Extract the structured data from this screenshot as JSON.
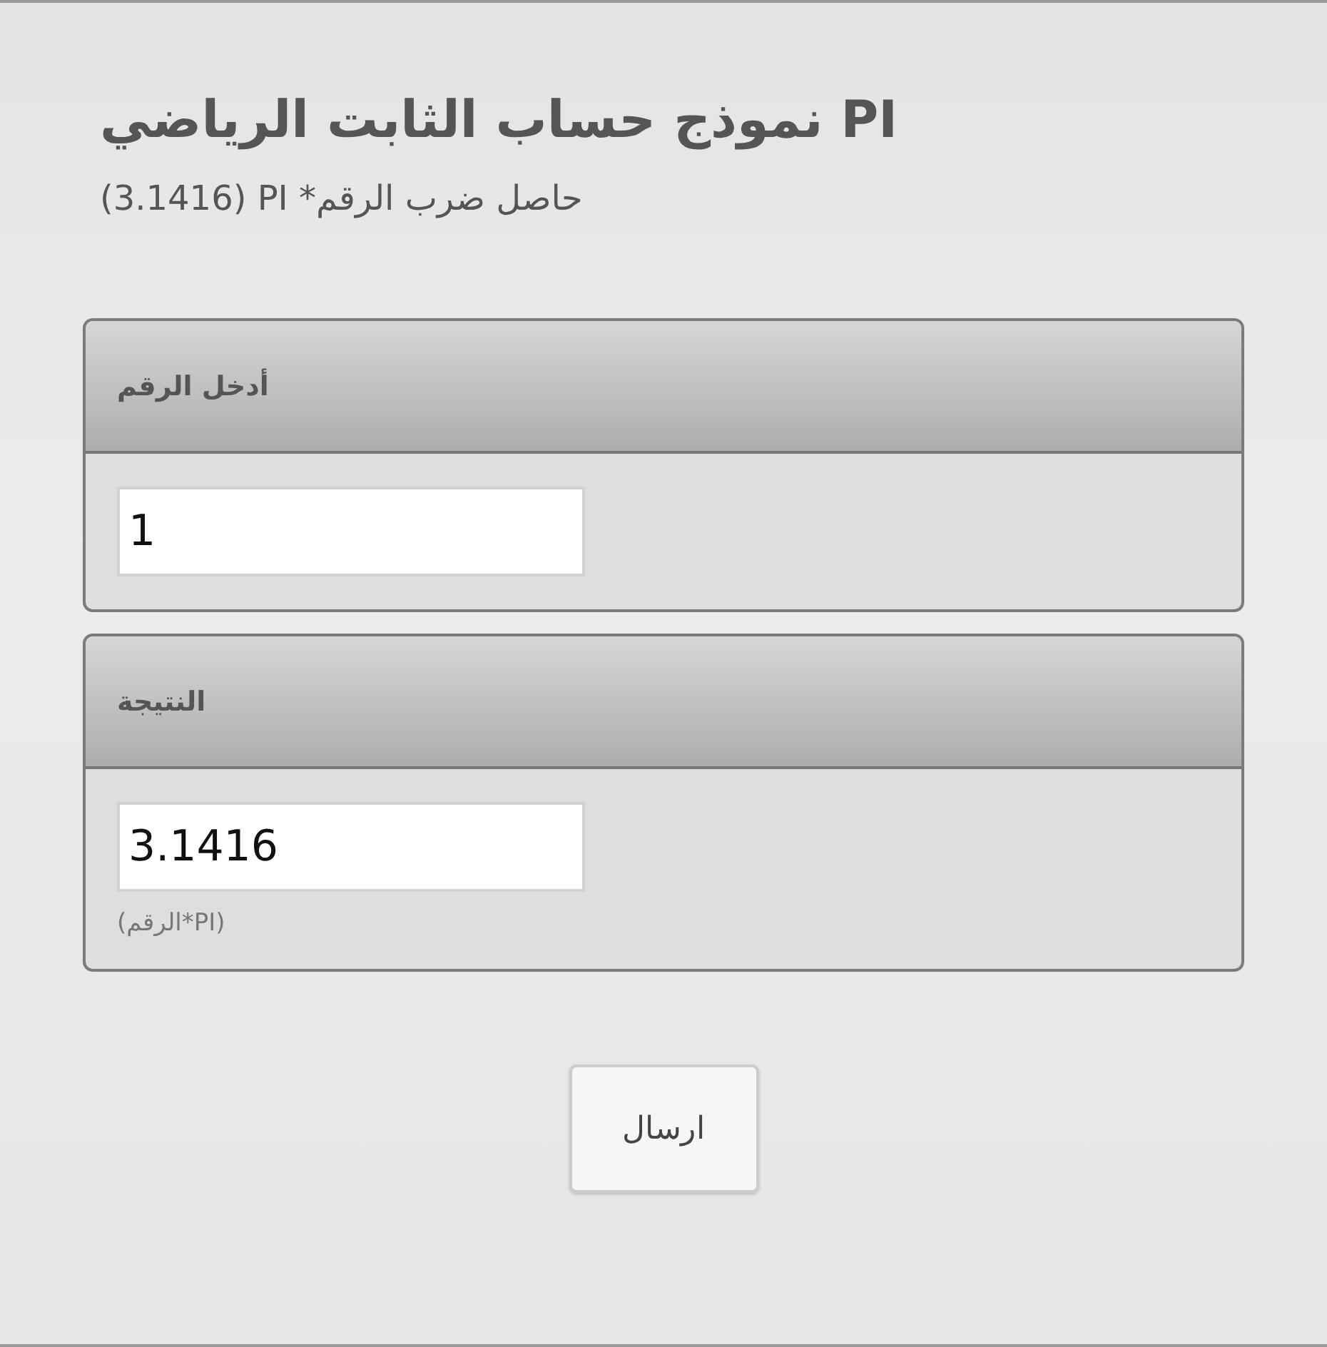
{
  "title": "نموذج حساب الثابت الرياضي PI",
  "subtitle": "(3.1416) PI *حاصل ضرب الرقم",
  "panels": [
    {
      "heading": "أدخل الرقم",
      "field": {
        "value": "1"
      }
    },
    {
      "heading": "النتيجة",
      "field": {
        "value": "3.1416"
      },
      "hint": "(الرقم*PI)"
    }
  ],
  "submit_button": "ارسال"
}
